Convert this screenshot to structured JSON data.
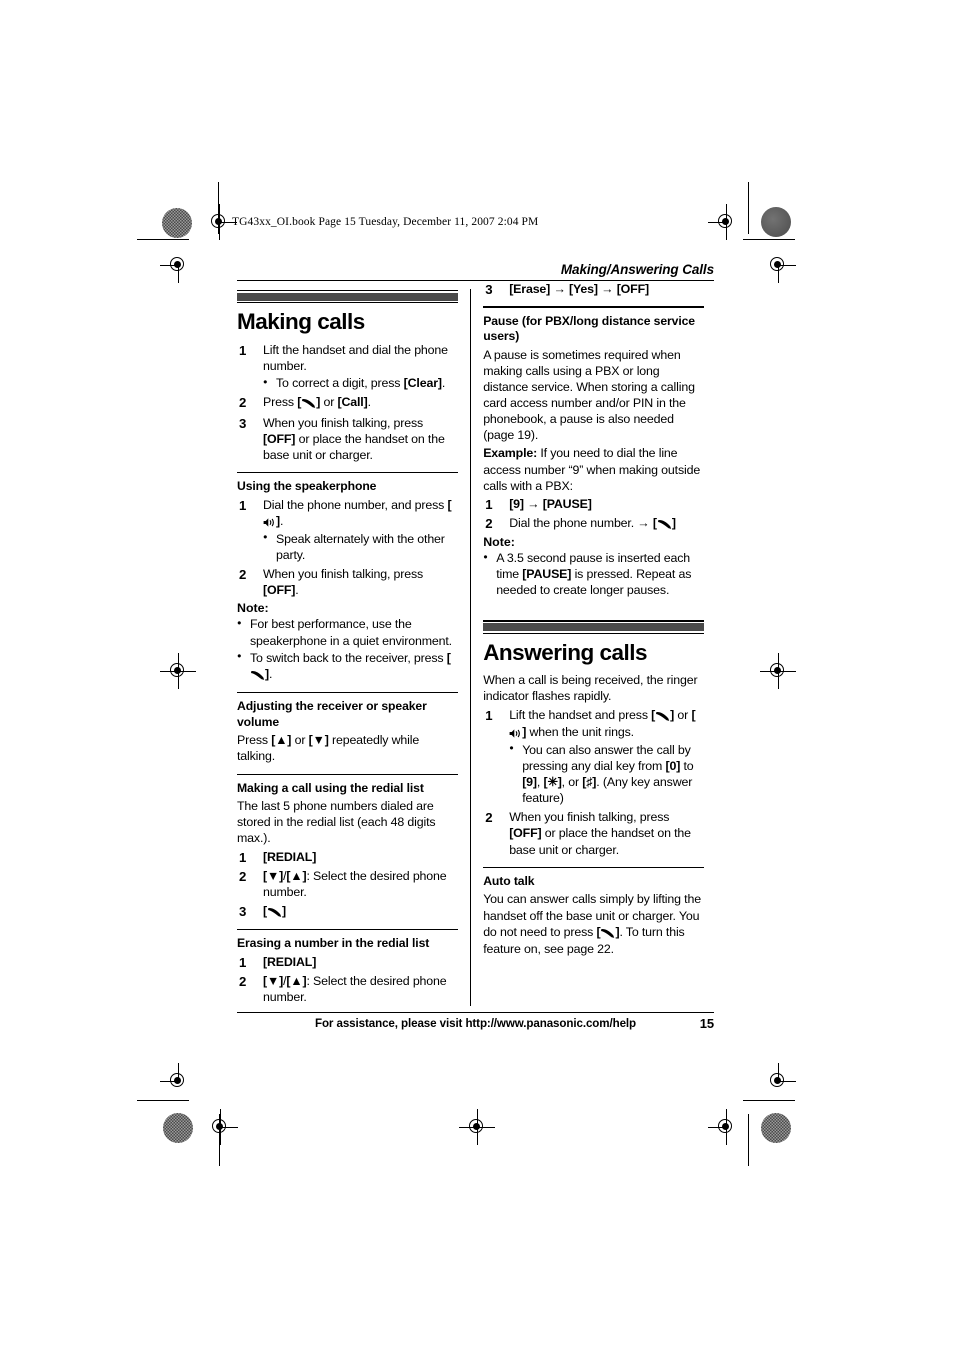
{
  "slug": "TG43xx_OI.book  Page 15  Tuesday, December 11, 2007  2:04 PM",
  "running_header": "Making/Answering Calls",
  "colors": {
    "section_bar": "#4a4a4a",
    "text": "#000000",
    "page_bg": "#ffffff"
  },
  "left_column": {
    "section": {
      "title": "Making calls",
      "steps": [
        {
          "num": "1",
          "text": "Lift the handset and dial the phone number.",
          "bullets": [
            "To correct a digit, press [Clear]."
          ]
        },
        {
          "num": "2",
          "text": "Press [⌕] or [Call]."
        },
        {
          "num": "3",
          "text": "When you finish talking, press [OFF] or place the handset on the base unit or charger."
        }
      ]
    },
    "speakerphone": {
      "heading": "Using the speakerphone",
      "steps": [
        {
          "num": "1",
          "text": "Dial the phone number, and press [⌗].",
          "bullets": [
            "Speak alternately with the other party."
          ]
        },
        {
          "num": "2",
          "text": "When you finish talking, press [OFF]."
        }
      ],
      "note_label": "Note:",
      "notes": [
        "For best performance, use the speakerphone in a quiet environment.",
        "To switch back to the receiver, press [⌕]."
      ]
    },
    "volume": {
      "heading": "Adjusting the receiver or speaker volume",
      "body": "Press [▲] or [▼] repeatedly while talking."
    },
    "redial": {
      "heading": "Making a call using the redial list",
      "body": "The last 5 phone numbers dialed are stored in the redial list (each 48 digits max.).",
      "steps": [
        {
          "num": "1",
          "text": "[REDIAL]"
        },
        {
          "num": "2",
          "text": "[▼]/[▲]: Select the desired phone number."
        },
        {
          "num": "3",
          "text": "[⌕]"
        }
      ]
    },
    "erase": {
      "heading": "Erasing a number in the redial list",
      "steps": [
        {
          "num": "1",
          "text": "[REDIAL]"
        },
        {
          "num": "2",
          "text": "[▼]/[▲]: Select the desired phone number."
        }
      ]
    }
  },
  "right_column": {
    "erase_step3": {
      "num": "3",
      "text": "[Erase] → [Yes] → [OFF]"
    },
    "pause": {
      "heading": "Pause (for PBX/long distance service users)",
      "body": "A pause is sometimes required when making calls using a PBX or long distance service. When storing a calling card access number and/or PIN in the phonebook, a pause is also needed (page 19).",
      "example_label": "Example:",
      "example_body": " If you need to dial the line access number “9” when making outside calls with a PBX:",
      "steps": [
        {
          "num": "1",
          "text": "[9] → [PAUSE]"
        },
        {
          "num": "2",
          "text": "Dial the phone number. → [⌕]"
        }
      ],
      "note_label": "Note:",
      "notes": [
        "A 3.5 second pause is inserted each time [PAUSE] is pressed. Repeat as needed to create longer pauses."
      ]
    },
    "section": {
      "title": "Answering calls",
      "intro": "When a call is being received, the ringer indicator flashes rapidly.",
      "steps": [
        {
          "num": "1",
          "text": "Lift the handset and press [⌕] or [⌗] when the unit rings.",
          "bullets": [
            "You can also answer the call by pressing any dial key from [0] to [9], [✳], or [♯]. (Any key answer feature)"
          ]
        },
        {
          "num": "2",
          "text": "When you finish talking, press [OFF] or place the handset on the base unit or charger."
        }
      ]
    },
    "auto_talk": {
      "heading": "Auto talk",
      "body": "You can answer calls simply by lifting the handset off the base unit or charger. You do not need to press [⌕]. To turn this feature on, see page 22."
    }
  },
  "footer": {
    "text": "For assistance, please visit http://www.panasonic.com/help",
    "page_number": "15"
  }
}
